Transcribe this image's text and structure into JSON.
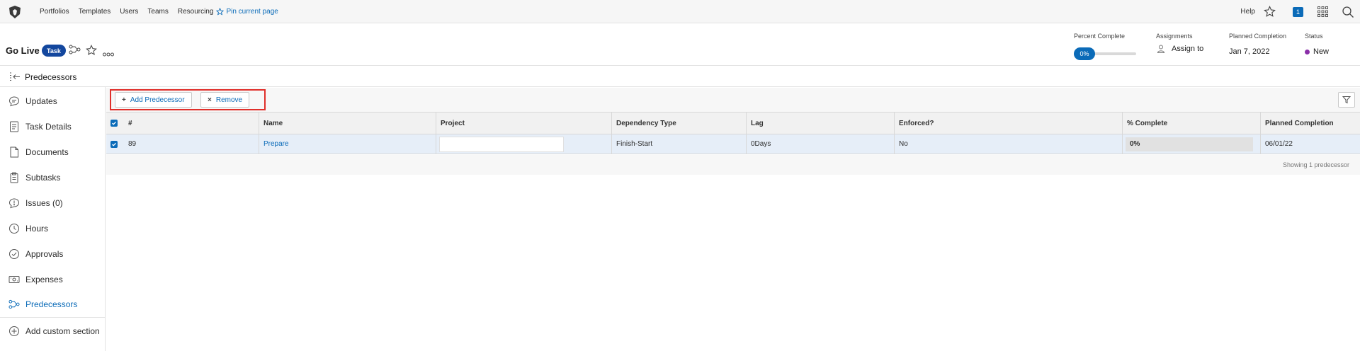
{
  "topnav": {
    "items": [
      "Portfolios",
      "Templates",
      "Users",
      "Teams",
      "Resourcing"
    ],
    "pin_label": "Pin current page",
    "help_label": "Help",
    "notification_count": "1"
  },
  "header": {
    "title": "Go Live",
    "badge": "Task",
    "percent_complete": {
      "label": "Percent Complete",
      "value": "0%"
    },
    "assignments": {
      "label": "Assignments",
      "value": "Assign to"
    },
    "planned_completion": {
      "label": "Planned Completion",
      "value": "Jan 7, 2022"
    },
    "status": {
      "label": "Status",
      "value": "New",
      "color": "#8a2ea8"
    }
  },
  "subheader": {
    "title": "Predecessors"
  },
  "sidebar": {
    "items": [
      {
        "label": "Updates",
        "icon": "chat-bubble-icon"
      },
      {
        "label": "Task Details",
        "icon": "document-lines-icon"
      },
      {
        "label": "Documents",
        "icon": "document-icon"
      },
      {
        "label": "Subtasks",
        "icon": "clipboard-icon"
      },
      {
        "label": "Issues (0)",
        "icon": "issue-icon"
      },
      {
        "label": "Hours",
        "icon": "clock-icon"
      },
      {
        "label": "Approvals",
        "icon": "check-circle-icon"
      },
      {
        "label": "Expenses",
        "icon": "money-icon"
      },
      {
        "label": "Predecessors",
        "icon": "predecessor-icon"
      }
    ],
    "add_section_label": "Add custom section"
  },
  "toolbar": {
    "add_label": "Add Predecessor",
    "remove_label": "Remove"
  },
  "table": {
    "columns": [
      "#",
      "Name",
      "Project",
      "Dependency Type",
      "Lag",
      "Enforced?",
      "% Complete",
      "Planned Completion"
    ],
    "rows": [
      {
        "num": "89",
        "name": "Prepare",
        "project": "",
        "dependency_type": "Finish-Start",
        "lag": "0Days",
        "enforced": "No",
        "percent_complete": "0%",
        "planned_completion": "06/01/22"
      }
    ],
    "footer": "Showing 1 predecessor"
  },
  "colors": {
    "accent": "#0b6bb8",
    "badge": "#13479e",
    "highlight": "#e0302b"
  }
}
